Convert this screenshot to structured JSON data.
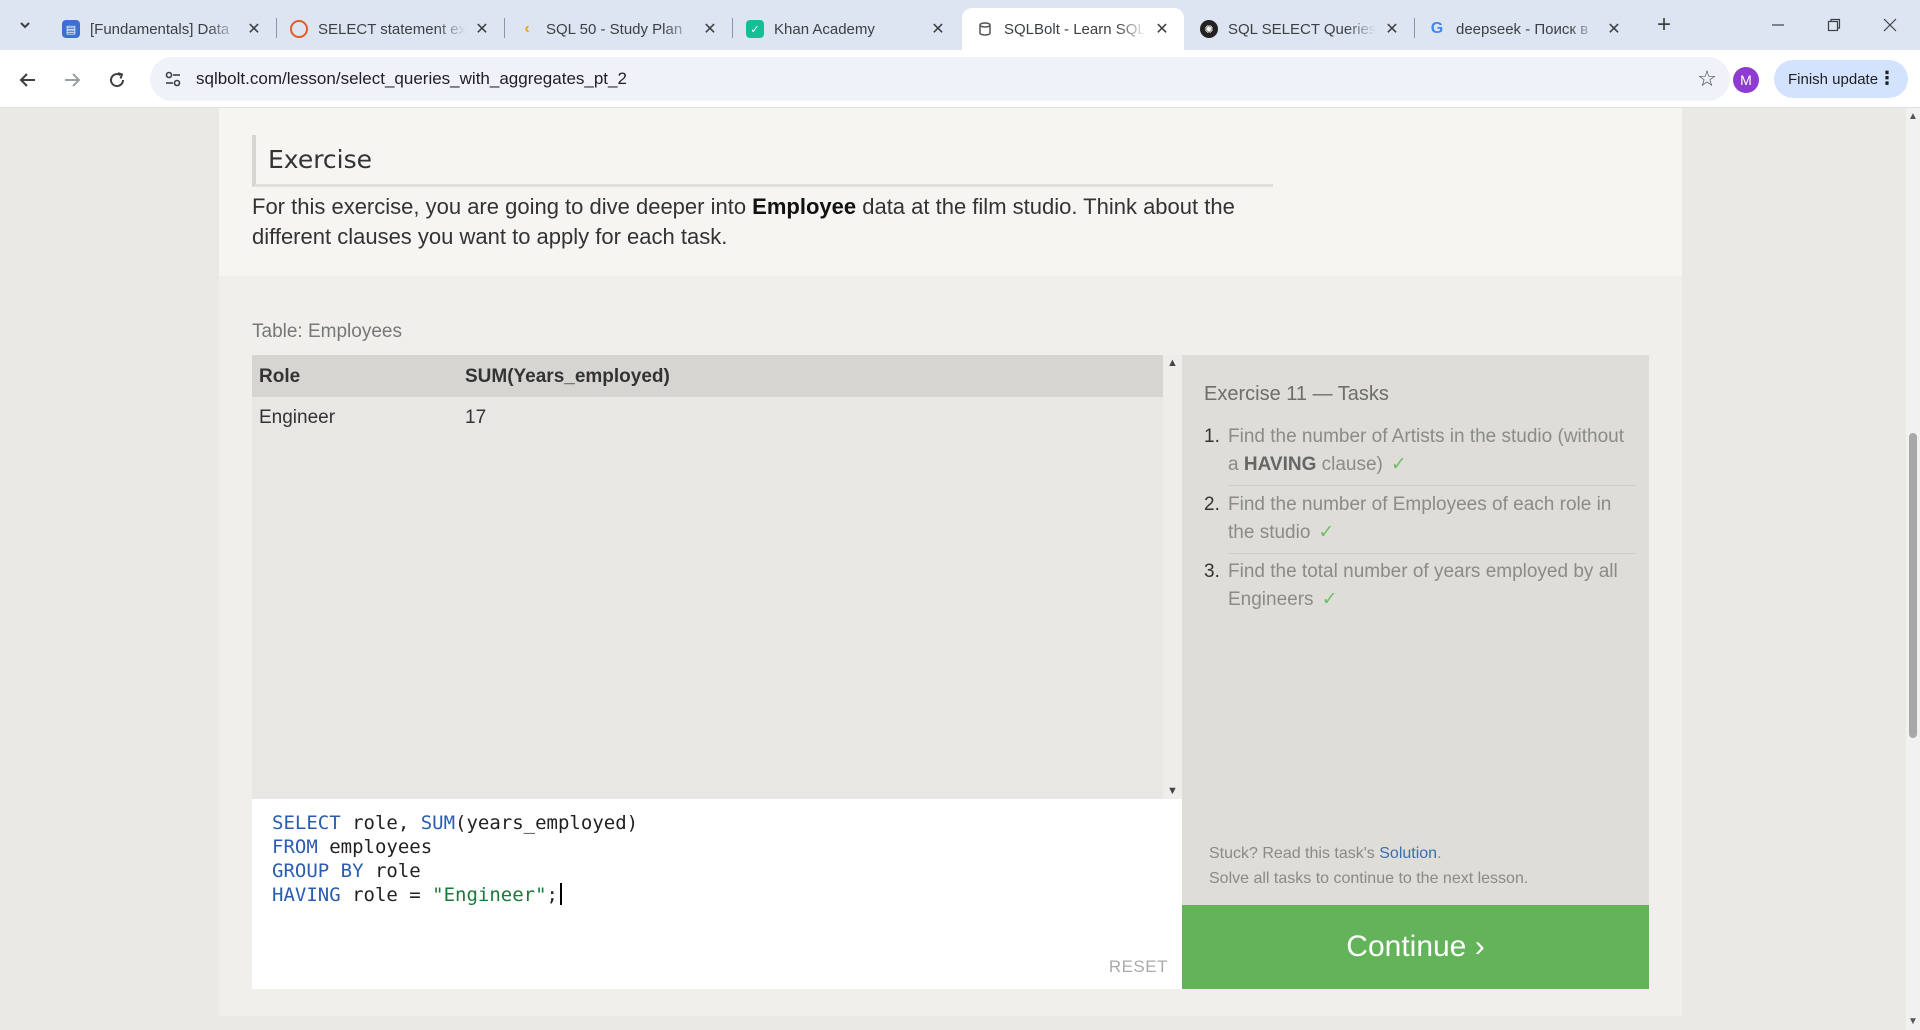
{
  "browser": {
    "tabs": [
      {
        "title": "[Fundamentals] Data",
        "favicon": "book-icon",
        "color": "#3d6fd1"
      },
      {
        "title": "SELECT statement ex",
        "favicon": "target-icon",
        "color": "#e25c2a"
      },
      {
        "title": "SQL 50 - Study Plan",
        "favicon": "leetcode-icon",
        "color": "#f0a30a"
      },
      {
        "title": "Khan Academy",
        "favicon": "khan-icon",
        "color": "#14bf96"
      },
      {
        "title": "SQLBolt - Learn SQL",
        "favicon": "database-icon",
        "color": "#555555",
        "active": true
      },
      {
        "title": "SQL SELECT Queries",
        "favicon": "openai-icon",
        "color": "#222222"
      },
      {
        "title": "deepseek - Поиск в",
        "favicon": "google-icon",
        "color": "#4285f4"
      }
    ],
    "url": "sqlbolt.com/lesson/select_queries_with_aggregates_pt_2",
    "profile_initial": "M",
    "finish_update": "Finish update"
  },
  "page": {
    "exercise_heading": "Exercise",
    "intro_before": "For this exercise, you are going to dive deeper into ",
    "intro_bold": "Employee",
    "intro_after": " data at the film studio. Think about the different clauses you want to apply for each task.",
    "table_caption": "Table: Employees",
    "results": {
      "columns": [
        "Role",
        "SUM(Years_employed)"
      ],
      "rows": [
        [
          "Engineer",
          "17"
        ]
      ]
    },
    "editor": {
      "lines": [
        [
          {
            "k": "SELECT"
          },
          {
            "t": " role, "
          },
          {
            "k": "SUM"
          },
          {
            "t": "(years_employed)"
          }
        ],
        [
          {
            "k": "FROM"
          },
          {
            "t": " employees"
          }
        ],
        [
          {
            "k": "GROUP BY"
          },
          {
            "t": " role"
          }
        ],
        [
          {
            "k": "HAVING"
          },
          {
            "t": " role = "
          },
          {
            "s": "\"Engineer\""
          },
          {
            "t": ";"
          }
        ]
      ],
      "reset_label": "RESET"
    },
    "tasks": {
      "title": "Exercise 11 — Tasks",
      "items": [
        {
          "num": "1.",
          "text_before": "Find the number of Artists in the studio (without a ",
          "bold": "HAVING",
          "text_after": " clause)",
          "check": "✓"
        },
        {
          "num": "2.",
          "text_before": "Find the number of Employees of each role in the studio",
          "bold": "",
          "text_after": "",
          "check": "✓"
        },
        {
          "num": "3.",
          "text_before": "Find the total number of years employed by all Engineers",
          "bold": "",
          "text_after": "",
          "check": "✓"
        }
      ],
      "stuck_before": "Stuck? Read this task's ",
      "stuck_link": "Solution",
      "stuck_after": ".",
      "stuck_line2": "Solve all tasks to continue to the next lesson."
    },
    "continue_label": "Continue ›",
    "colors": {
      "continue": "#63b35a",
      "link": "#3a6fb0",
      "check": "#6fbf6a"
    }
  }
}
